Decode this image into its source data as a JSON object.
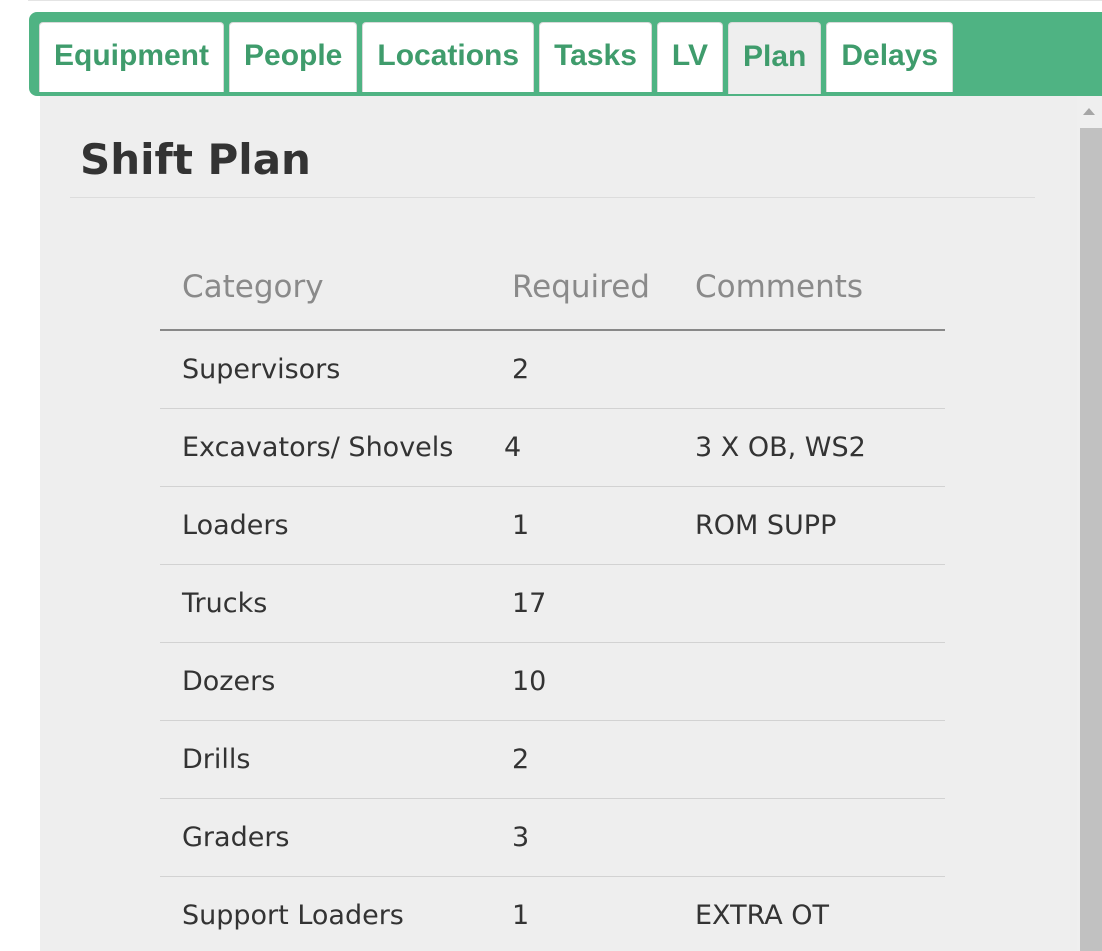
{
  "tabs": [
    {
      "label": "Equipment",
      "active": false
    },
    {
      "label": "People",
      "active": false
    },
    {
      "label": "Locations",
      "active": false
    },
    {
      "label": "Tasks",
      "active": false
    },
    {
      "label": "LV",
      "active": false
    },
    {
      "label": "Plan",
      "active": true
    },
    {
      "label": "Delays",
      "active": false
    }
  ],
  "page_title": "Shift Plan",
  "table": {
    "headers": {
      "category": "Category",
      "required": "Required",
      "comments": "Comments"
    },
    "rows": [
      {
        "category": "Supervisors",
        "required": "2",
        "comments": ""
      },
      {
        "category": "Excavators/ Shovels",
        "required": "4",
        "comments": "3 X OB, WS2"
      },
      {
        "category": "Loaders",
        "required": "1",
        "comments": "ROM SUPP"
      },
      {
        "category": "Trucks",
        "required": "17",
        "comments": ""
      },
      {
        "category": "Dozers",
        "required": "10",
        "comments": ""
      },
      {
        "category": "Drills",
        "required": "2",
        "comments": ""
      },
      {
        "category": "Graders",
        "required": "3",
        "comments": ""
      },
      {
        "category": "Support Loaders",
        "required": "1",
        "comments": "EXTRA OT"
      }
    ]
  },
  "colors": {
    "tab_bar": "#4fb383",
    "tab_text": "#3f9c6c",
    "panel_bg": "#eeeeee"
  }
}
